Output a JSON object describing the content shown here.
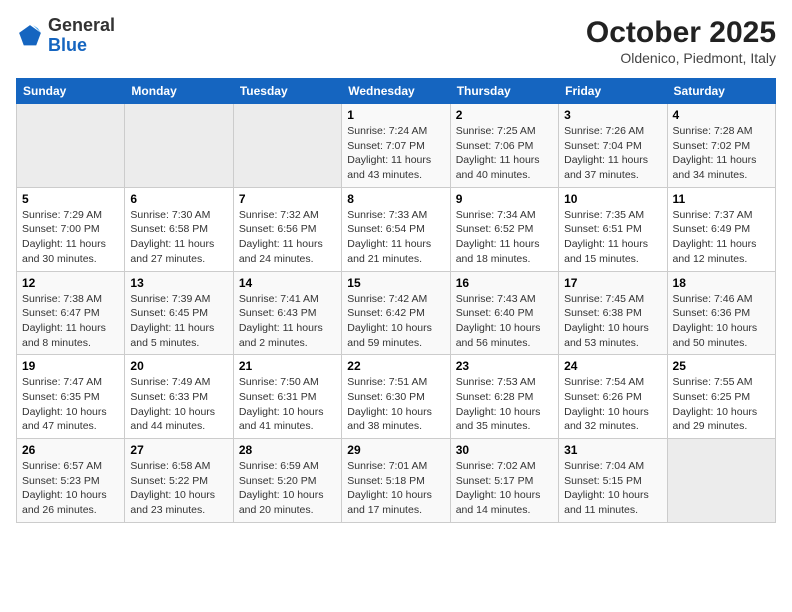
{
  "header": {
    "logo_general": "General",
    "logo_blue": "Blue",
    "month": "October 2025",
    "location": "Oldenico, Piedmont, Italy"
  },
  "weekdays": [
    "Sunday",
    "Monday",
    "Tuesday",
    "Wednesday",
    "Thursday",
    "Friday",
    "Saturday"
  ],
  "rows": [
    {
      "cells": [
        {
          "day": "",
          "info": ""
        },
        {
          "day": "",
          "info": ""
        },
        {
          "day": "",
          "info": ""
        },
        {
          "day": "1",
          "info": "Sunrise: 7:24 AM\nSunset: 7:07 PM\nDaylight: 11 hours\nand 43 minutes."
        },
        {
          "day": "2",
          "info": "Sunrise: 7:25 AM\nSunset: 7:06 PM\nDaylight: 11 hours\nand 40 minutes."
        },
        {
          "day": "3",
          "info": "Sunrise: 7:26 AM\nSunset: 7:04 PM\nDaylight: 11 hours\nand 37 minutes."
        },
        {
          "day": "4",
          "info": "Sunrise: 7:28 AM\nSunset: 7:02 PM\nDaylight: 11 hours\nand 34 minutes."
        }
      ]
    },
    {
      "cells": [
        {
          "day": "5",
          "info": "Sunrise: 7:29 AM\nSunset: 7:00 PM\nDaylight: 11 hours\nand 30 minutes."
        },
        {
          "day": "6",
          "info": "Sunrise: 7:30 AM\nSunset: 6:58 PM\nDaylight: 11 hours\nand 27 minutes."
        },
        {
          "day": "7",
          "info": "Sunrise: 7:32 AM\nSunset: 6:56 PM\nDaylight: 11 hours\nand 24 minutes."
        },
        {
          "day": "8",
          "info": "Sunrise: 7:33 AM\nSunset: 6:54 PM\nDaylight: 11 hours\nand 21 minutes."
        },
        {
          "day": "9",
          "info": "Sunrise: 7:34 AM\nSunset: 6:52 PM\nDaylight: 11 hours\nand 18 minutes."
        },
        {
          "day": "10",
          "info": "Sunrise: 7:35 AM\nSunset: 6:51 PM\nDaylight: 11 hours\nand 15 minutes."
        },
        {
          "day": "11",
          "info": "Sunrise: 7:37 AM\nSunset: 6:49 PM\nDaylight: 11 hours\nand 12 minutes."
        }
      ]
    },
    {
      "cells": [
        {
          "day": "12",
          "info": "Sunrise: 7:38 AM\nSunset: 6:47 PM\nDaylight: 11 hours\nand 8 minutes."
        },
        {
          "day": "13",
          "info": "Sunrise: 7:39 AM\nSunset: 6:45 PM\nDaylight: 11 hours\nand 5 minutes."
        },
        {
          "day": "14",
          "info": "Sunrise: 7:41 AM\nSunset: 6:43 PM\nDaylight: 11 hours\nand 2 minutes."
        },
        {
          "day": "15",
          "info": "Sunrise: 7:42 AM\nSunset: 6:42 PM\nDaylight: 10 hours\nand 59 minutes."
        },
        {
          "day": "16",
          "info": "Sunrise: 7:43 AM\nSunset: 6:40 PM\nDaylight: 10 hours\nand 56 minutes."
        },
        {
          "day": "17",
          "info": "Sunrise: 7:45 AM\nSunset: 6:38 PM\nDaylight: 10 hours\nand 53 minutes."
        },
        {
          "day": "18",
          "info": "Sunrise: 7:46 AM\nSunset: 6:36 PM\nDaylight: 10 hours\nand 50 minutes."
        }
      ]
    },
    {
      "cells": [
        {
          "day": "19",
          "info": "Sunrise: 7:47 AM\nSunset: 6:35 PM\nDaylight: 10 hours\nand 47 minutes."
        },
        {
          "day": "20",
          "info": "Sunrise: 7:49 AM\nSunset: 6:33 PM\nDaylight: 10 hours\nand 44 minutes."
        },
        {
          "day": "21",
          "info": "Sunrise: 7:50 AM\nSunset: 6:31 PM\nDaylight: 10 hours\nand 41 minutes."
        },
        {
          "day": "22",
          "info": "Sunrise: 7:51 AM\nSunset: 6:30 PM\nDaylight: 10 hours\nand 38 minutes."
        },
        {
          "day": "23",
          "info": "Sunrise: 7:53 AM\nSunset: 6:28 PM\nDaylight: 10 hours\nand 35 minutes."
        },
        {
          "day": "24",
          "info": "Sunrise: 7:54 AM\nSunset: 6:26 PM\nDaylight: 10 hours\nand 32 minutes."
        },
        {
          "day": "25",
          "info": "Sunrise: 7:55 AM\nSunset: 6:25 PM\nDaylight: 10 hours\nand 29 minutes."
        }
      ]
    },
    {
      "cells": [
        {
          "day": "26",
          "info": "Sunrise: 6:57 AM\nSunset: 5:23 PM\nDaylight: 10 hours\nand 26 minutes."
        },
        {
          "day": "27",
          "info": "Sunrise: 6:58 AM\nSunset: 5:22 PM\nDaylight: 10 hours\nand 23 minutes."
        },
        {
          "day": "28",
          "info": "Sunrise: 6:59 AM\nSunset: 5:20 PM\nDaylight: 10 hours\nand 20 minutes."
        },
        {
          "day": "29",
          "info": "Sunrise: 7:01 AM\nSunset: 5:18 PM\nDaylight: 10 hours\nand 17 minutes."
        },
        {
          "day": "30",
          "info": "Sunrise: 7:02 AM\nSunset: 5:17 PM\nDaylight: 10 hours\nand 14 minutes."
        },
        {
          "day": "31",
          "info": "Sunrise: 7:04 AM\nSunset: 5:15 PM\nDaylight: 10 hours\nand 11 minutes."
        },
        {
          "day": "",
          "info": ""
        }
      ]
    }
  ]
}
